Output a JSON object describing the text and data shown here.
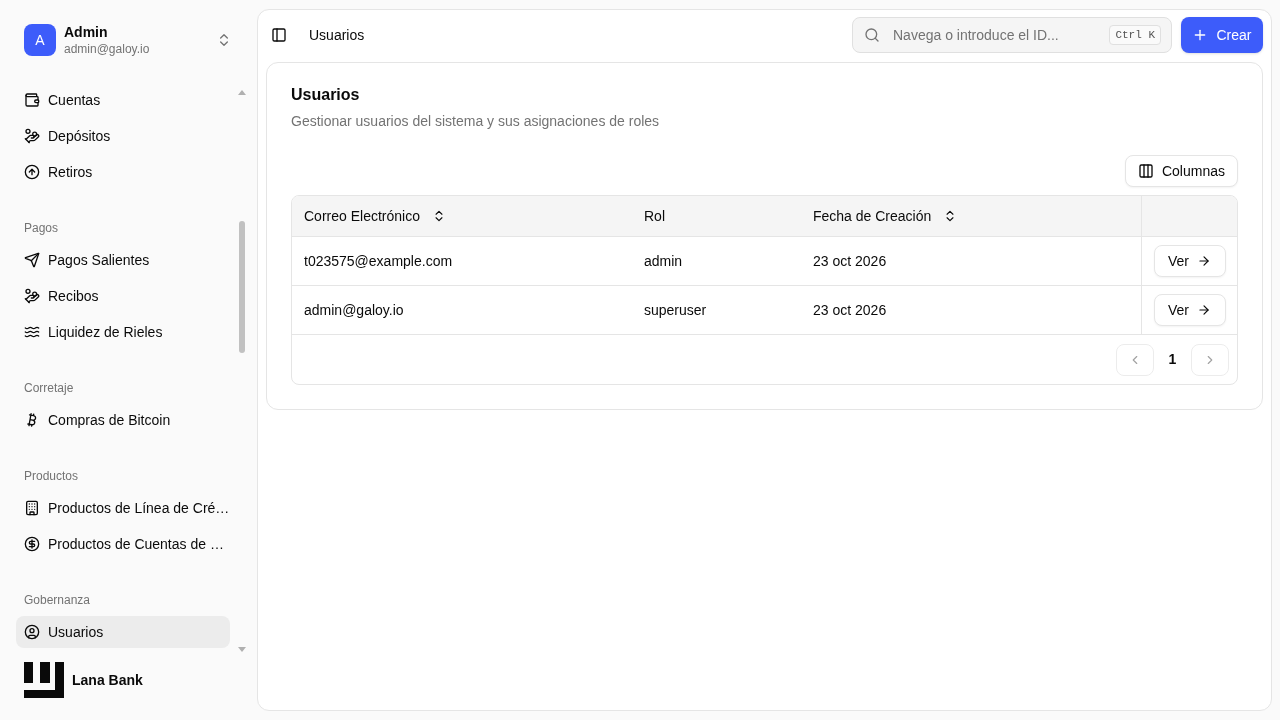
{
  "user": {
    "initial": "A",
    "name": "Admin",
    "email": "admin@galoy.io"
  },
  "sidebar": {
    "groups": [
      {
        "items": [
          {
            "label": "Cuentas",
            "selected": false
          },
          {
            "label": "Depósitos",
            "selected": false
          },
          {
            "label": "Retiros",
            "selected": false
          }
        ]
      },
      {
        "label": "Pagos",
        "items": [
          {
            "label": "Pagos Salientes",
            "selected": false
          },
          {
            "label": "Recibos",
            "selected": false
          },
          {
            "label": "Liquidez de Rieles",
            "selected": false
          }
        ]
      },
      {
        "label": "Corretaje",
        "items": [
          {
            "label": "Compras de Bitcoin",
            "selected": false
          }
        ]
      },
      {
        "label": "Productos",
        "items": [
          {
            "label": "Productos de Línea de Cré…",
            "selected": false
          },
          {
            "label": "Productos de Cuentas de …",
            "selected": false
          }
        ]
      },
      {
        "label": "Gobernanza",
        "items": [
          {
            "label": "Usuarios",
            "selected": true
          }
        ]
      }
    ]
  },
  "brand": {
    "name": "Lana Bank"
  },
  "topbar": {
    "breadcrumb": "Usuarios",
    "search": {
      "placeholder": "Navega o introduce el ID...",
      "shortcut": "Ctrl K"
    },
    "create_button": "Crear"
  },
  "page": {
    "title": "Usuarios",
    "description": "Gestionar usuarios del sistema y sus asignaciones de roles",
    "columns_button": "Columnas",
    "table": {
      "columns": [
        {
          "label": "Correo Electrónico",
          "sortable": true
        },
        {
          "label": "Rol",
          "sortable": false
        },
        {
          "label": "Fecha de Creación",
          "sortable": true
        }
      ],
      "rows": [
        {
          "cells": [
            "t023575@example.com",
            "admin",
            "23 oct 2026"
          ],
          "action": "Ver"
        },
        {
          "cells": [
            "admin@galoy.io",
            "superuser",
            "23 oct 2026"
          ],
          "action": "Ver"
        }
      ],
      "pagination": {
        "page": "1",
        "previous_disabled": true,
        "next_disabled": true
      }
    }
  }
}
